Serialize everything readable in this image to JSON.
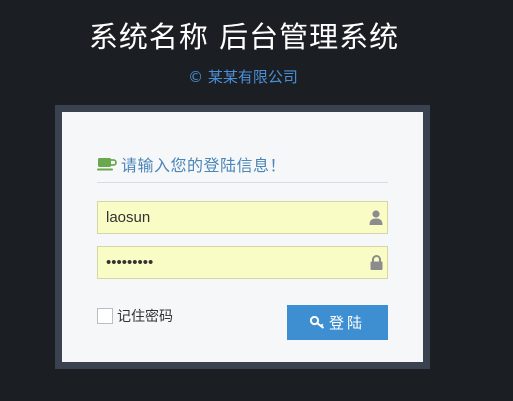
{
  "header": {
    "title": "系统名称 后台管理系统",
    "copyright": "© 某某有限公司"
  },
  "login": {
    "heading": "请输入您的登陆信息！",
    "heading_icon": "coffee-icon",
    "username": {
      "value": "laosun",
      "icon": "user-icon"
    },
    "password": {
      "value": "password1",
      "icon": "lock-icon"
    },
    "remember_label": "记住密码",
    "remember_checked": false,
    "submit_label": "登陆",
    "submit_icon": "key-icon"
  },
  "colors": {
    "background": "#1b1e22",
    "accent": "#3e8fd1",
    "heading_text": "#4a86b8",
    "input_fill": "#fafcc6",
    "card": "#f6f7f8",
    "frame": "#3a4250"
  }
}
